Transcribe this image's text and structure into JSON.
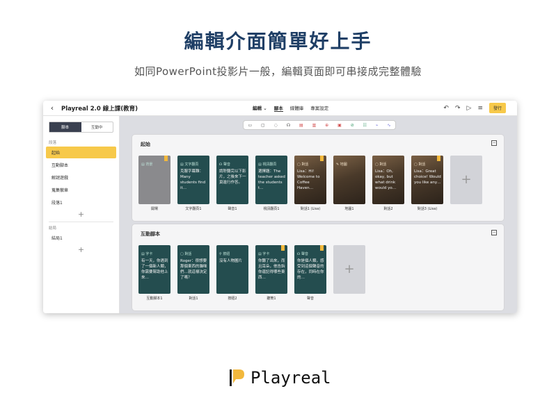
{
  "headline": "編輯介面簡單好上手",
  "subheadline": "如同PowerPoint投影片一般，編輯頁面即可串接成完整體驗",
  "app": {
    "back": "‹",
    "project_title": "Playreal 2.0 線上課(教育)",
    "menus": [
      "編輯 ⌄",
      "腳本",
      "媒體庫",
      "專案設定"
    ],
    "publish": "發行",
    "icons": [
      "↶",
      "↷",
      "▷",
      "≡"
    ]
  },
  "sidebar": {
    "tabs": [
      "腳本",
      "互動中"
    ],
    "group1": "段落",
    "items": [
      "起始",
      "互動腳本",
      "解謎遊戲",
      "蒐集徽章",
      "段落1"
    ],
    "group2": "結局",
    "items2": [
      "結局1"
    ],
    "plus": "+"
  },
  "toolbar": {
    "icons": [
      "▭",
      "▢",
      "◌",
      "☊",
      "▤",
      "▥",
      "⊕",
      "▣",
      "⊘",
      "☷",
      "⌁",
      "∿"
    ]
  },
  "section1": {
    "title": "起始",
    "toggle": "−",
    "cards": [
      {
        "head": "▤ 背景",
        "text": "",
        "label": "開場",
        "style": "gray",
        "mark": true
      },
      {
        "head": "▤ 文字翻頁",
        "text": "克服字幕難：Many students find it…",
        "label": "文字翻頁1",
        "style": "teal",
        "mark": false
      },
      {
        "head": "☊ 聲音",
        "text": "請聆聽完以下影片，之後來下一頁進行作答。",
        "label": "聲音1",
        "style": "teal",
        "mark": false
      },
      {
        "head": "▤ 視訊翻頁",
        "text": "選擇題：The teacher asked the students t…",
        "label": "視訊翻頁1",
        "style": "teal",
        "mark": false
      },
      {
        "head": "▢ 對話",
        "text": "Lisa：Hi! Welcome to Coffee Haven…",
        "label": "對話1 (Lisa)",
        "style": "photo",
        "mark": true
      },
      {
        "head": "✎ 地圖",
        "text": "",
        "label": "地圖1",
        "style": "photo",
        "mark": false
      },
      {
        "head": "▢ 對話",
        "text": "Lisa：Oh, okay, but what drink would yo…",
        "label": "對話2",
        "style": "photo",
        "mark": false
      },
      {
        "head": "▢ 對話",
        "text": "Lisa：Great choice! Would you like any…",
        "label": "對話3 (Lisa)",
        "style": "photo",
        "mark": true
      }
    ],
    "add": "+"
  },
  "section2": {
    "title": "互動腳本",
    "toggle": "−",
    "cards": [
      {
        "head": "▤ 字卡",
        "text": "有一天，你遇到了一個新人類，你需要幫助他上來…",
        "label": "互動腳本1",
        "style": "teal",
        "mark": false
      },
      {
        "head": "▢ 對話",
        "text": "Roger：很想要那個東西的貓咪們…就這樣決定了嗎？",
        "label": "對話1",
        "style": "teal",
        "mark": false
      },
      {
        "head": "⚲ 按鈕",
        "text": "沒有人物圖片",
        "label": "按鈕2",
        "style": "teal",
        "mark": false
      },
      {
        "head": "▤ 字卡",
        "text": "你聽了出來，而且耳朵，他告訴你還記得哪些東西…",
        "label": "聽筒1",
        "style": "teal",
        "mark": true
      },
      {
        "head": "☊ 聲音",
        "text": "你是個人類，感受到這個聲音的存在，同時在你的…",
        "label": "聲音",
        "style": "teal",
        "mark": true
      }
    ],
    "add": "+"
  },
  "brand": {
    "name": "Playreal",
    "color": "#f2b83c"
  }
}
